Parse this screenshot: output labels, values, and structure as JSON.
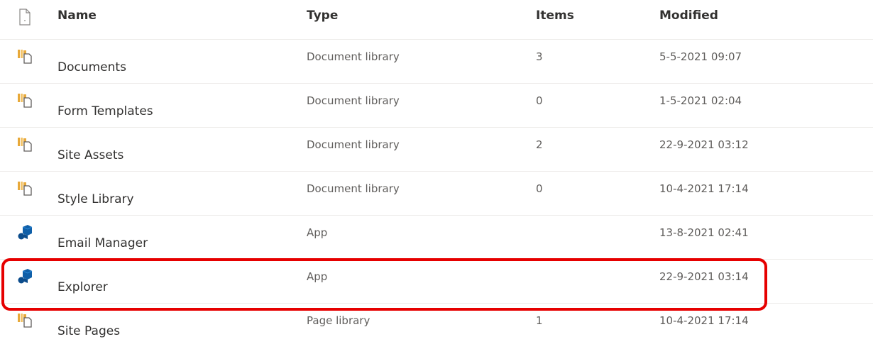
{
  "header": {
    "file_type_icon": "file-icon",
    "name": "Name",
    "type": "Type",
    "items": "Items",
    "modified": "Modified"
  },
  "rows": [
    {
      "icon": "document-library-icon",
      "name": "Documents",
      "type": "Document library",
      "items": "3",
      "modified": "5-5-2021 09:07"
    },
    {
      "icon": "document-library-icon",
      "name": "Form Templates",
      "type": "Document library",
      "items": "0",
      "modified": "1-5-2021 02:04"
    },
    {
      "icon": "document-library-icon",
      "name": "Site Assets",
      "type": "Document library",
      "items": "2",
      "modified": "22-9-2021 03:12"
    },
    {
      "icon": "document-library-icon",
      "name": "Style Library",
      "type": "Document library",
      "items": "0",
      "modified": "10-4-2021 17:14"
    },
    {
      "icon": "app-icon",
      "name": "Email Manager",
      "type": "App",
      "items": "",
      "modified": "13-8-2021 02:41"
    },
    {
      "icon": "app-icon",
      "name": "Explorer",
      "type": "App",
      "items": "",
      "modified": "22-9-2021 03:14"
    },
    {
      "icon": "document-library-icon",
      "name": "Site Pages",
      "type": "Page library",
      "items": "1",
      "modified": "10-4-2021 17:14"
    }
  ],
  "colors": {
    "highlight_border": "#e60000",
    "library_icon": "#e8a93a",
    "app_icon": "#0f5fa8",
    "row_divider": "#edebe9"
  },
  "highlighted_row": "Explorer"
}
